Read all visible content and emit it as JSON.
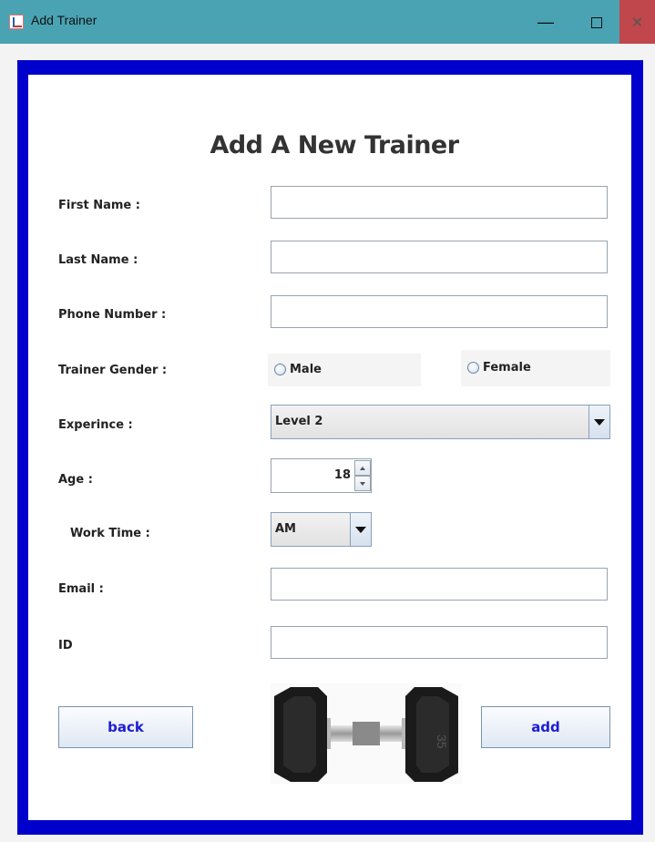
{
  "window": {
    "title": "Add Trainer",
    "minimize_glyph": "—",
    "close_glyph": "✕"
  },
  "form": {
    "heading": "Add A New Trainer",
    "first_name_label": "First Name :",
    "first_name_value": "",
    "last_name_label": "Last Name :",
    "last_name_value": "",
    "phone_label": "Phone Number :",
    "phone_value": "",
    "gender_label": "Trainer Gender :",
    "gender_options": [
      "Male",
      "Female"
    ],
    "experience_label": "Experince :",
    "experience_value": "Level 2",
    "age_label": "Age :",
    "age_value": "18",
    "work_time_label": "Work Time :",
    "work_time_value": "AM",
    "email_label": "Email :",
    "email_value": "",
    "id_label": "ID",
    "id_value": ""
  },
  "buttons": {
    "back": "back",
    "add": "add"
  },
  "image": {
    "icon": "dumbbell-image",
    "weight_label": "35"
  },
  "colors": {
    "titlebar": "#4aa3b3",
    "frame_border": "#0000cc",
    "button_text": "#1d1dd6"
  }
}
